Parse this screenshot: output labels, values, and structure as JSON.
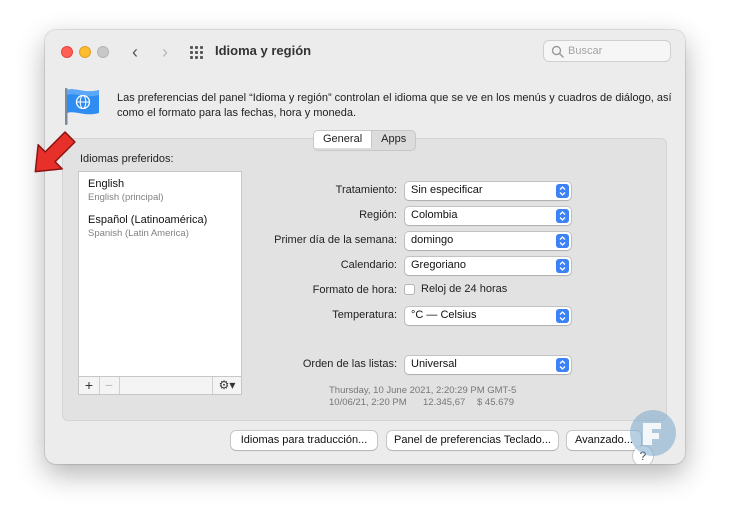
{
  "window": {
    "title": "Idioma y región"
  },
  "search": {
    "placeholder": "Buscar"
  },
  "description": "Las preferencias del panel “Idioma y región” controlan el idioma que se ve en los menús y cuadros de diálogo, así como el formato para las fechas, hora y moneda.",
  "tabs": [
    {
      "label": "General",
      "selected": true
    },
    {
      "label": "Apps",
      "selected": false
    }
  ],
  "preferred_languages": {
    "label": "Idiomas preferidos:",
    "items": [
      {
        "name": "English",
        "sub": "English (principal)"
      },
      {
        "name": "Español (Latinoamérica)",
        "sub": "Spanish (Latin America)"
      }
    ],
    "add_label": "+",
    "remove_label": "−"
  },
  "settings": {
    "tratamiento": {
      "label": "Tratamiento:",
      "value": "Sin especificar"
    },
    "region": {
      "label": "Región:",
      "value": "Colombia"
    },
    "primer_dia": {
      "label": "Primer día de la semana:",
      "value": "domingo"
    },
    "calendario": {
      "label": "Calendario:",
      "value": "Gregoriano"
    },
    "formato_hora": {
      "label": "Formato de hora:",
      "checkbox_label": "Reloj de 24 horas",
      "checked": false
    },
    "temperatura": {
      "label": "Temperatura:",
      "value": "°C — Celsius"
    },
    "orden_listas": {
      "label": "Orden de las listas:",
      "value": "Universal"
    }
  },
  "samples": {
    "line1": "Thursday, 10 June 2021, 2:20:29 PM GMT-5",
    "line2_date": "10/06/21, 2:20 PM",
    "line2_number": "12.345,67",
    "line2_currency": "$ 45.679"
  },
  "buttons": {
    "translation": "Idiomas para traducción...",
    "keyboard": "Panel de preferencias Teclado...",
    "advanced": "Avanzado...",
    "help": "?"
  },
  "colors": {
    "accent": "#3b82f6",
    "annotation_arrow": "#e8302a",
    "traffic_red": "#ff5f57",
    "traffic_yellow": "#febc2e"
  },
  "icons": [
    "chevron-left-icon",
    "chevron-right-icon",
    "grid-icon",
    "search-icon",
    "flag-globe-icon",
    "gear-icon",
    "chevron-updown-icon",
    "red-arrow-annotation",
    "logo-watermark"
  ]
}
